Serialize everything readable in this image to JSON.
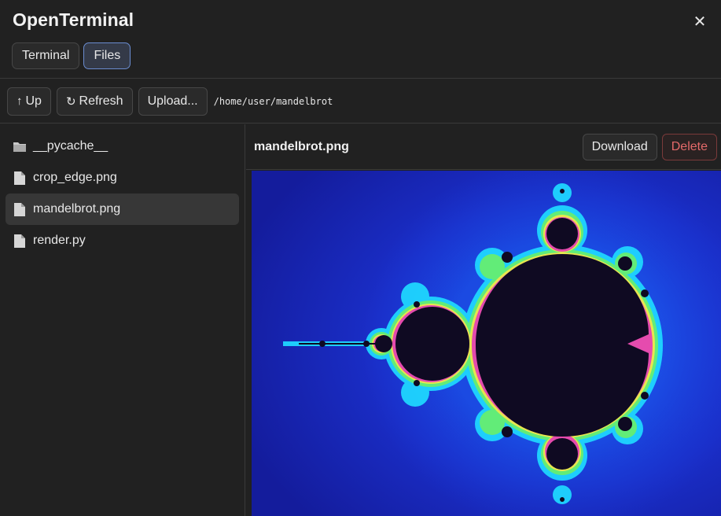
{
  "app": {
    "title": "OpenTerminal",
    "close_icon": "close-icon"
  },
  "tabs": [
    {
      "label": "Terminal",
      "active": false
    },
    {
      "label": "Files",
      "active": true
    }
  ],
  "toolbar": {
    "up_label": "Up",
    "up_icon": "arrow-up-icon",
    "refresh_label": "Refresh",
    "refresh_icon": "refresh-icon",
    "upload_label": "Upload...",
    "path": "/home/user/mandelbrot"
  },
  "files": [
    {
      "name": "__pycache__",
      "type": "folder",
      "icon": "folder-icon",
      "selected": false
    },
    {
      "name": "crop_edge.png",
      "type": "file",
      "icon": "file-icon",
      "selected": false
    },
    {
      "name": "mandelbrot.png",
      "type": "file",
      "icon": "file-icon",
      "selected": true
    },
    {
      "name": "render.py",
      "type": "file",
      "icon": "file-icon",
      "selected": false
    }
  ],
  "preview": {
    "filename": "mandelbrot.png",
    "download_label": "Download",
    "delete_label": "Delete",
    "image_description": "mandelbrot-fractal-image"
  },
  "colors": {
    "background": "#212121",
    "accent_tab_border": "#6a8ccf",
    "delete_text": "#e46a6a",
    "fractal_blue": "#1b27c9",
    "fractal_set": "#0f0a22"
  }
}
